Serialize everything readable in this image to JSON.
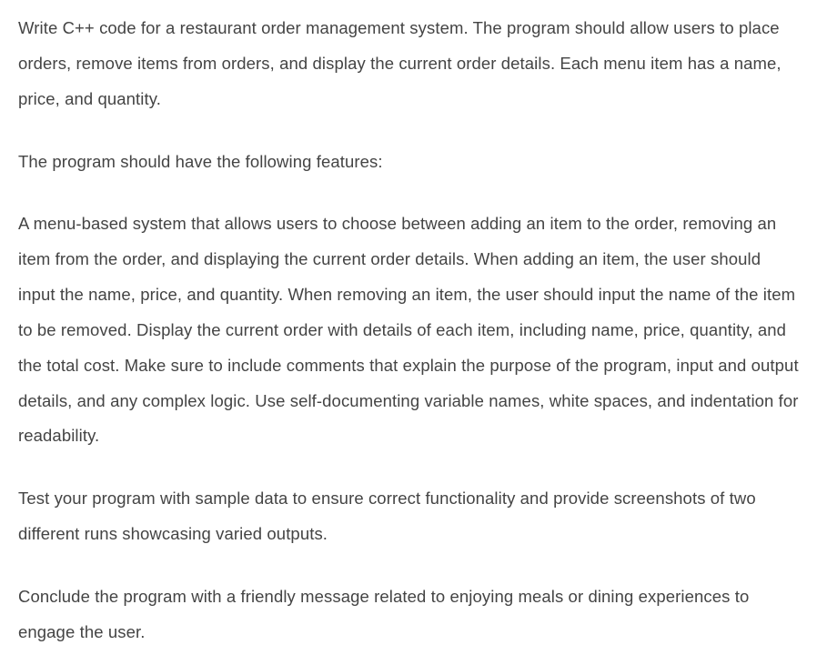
{
  "paragraphs": {
    "p1": "Write C++ code for a restaurant order management system. The program should allow users to place orders, remove items from orders, and display the current order details. Each menu item has a name, price, and quantity.",
    "p2": "The program should have the following features:",
    "p3": "A menu-based system that allows users to choose between adding an item to the order, removing an item from the order, and displaying the current order details. When adding an item, the user should input the name, price, and quantity. When removing an item, the user should input the name of the item to be removed. Display the current order with details of each item, including name, price, quantity, and the total cost. Make sure to include comments that explain the purpose of the program, input and output details, and any complex logic. Use self-documenting variable names, white spaces, and indentation for readability.",
    "p4": "Test your program with sample data to ensure correct functionality and provide screenshots of two different runs showcasing varied outputs.",
    "p5": "Conclude the program with a friendly message related to enjoying meals or dining experiences to engage the user."
  }
}
